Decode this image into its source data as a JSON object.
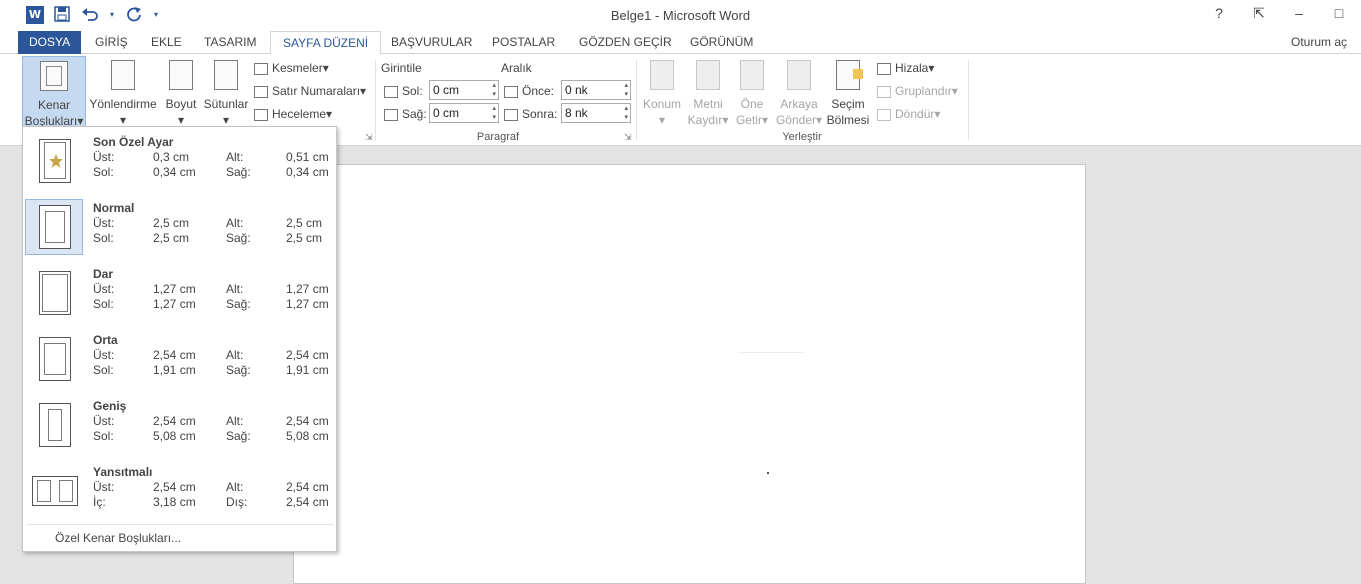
{
  "window": {
    "title": "Belge1 - Microsoft Word",
    "help": "?",
    "controls": [
      "⇱",
      "–",
      "□"
    ],
    "signin": "Oturum aç"
  },
  "qat": {
    "logo": "W",
    "save_icon": "save-icon",
    "undo_icon": "undo-icon",
    "redo_icon": "redo-icon"
  },
  "tabs": [
    "DOSYA",
    "GİRİŞ",
    "EKLE",
    "TASARIM",
    "SAYFA DÜZENİ",
    "BAŞVURULAR",
    "POSTALAR",
    "GÖZDEN GEÇİR",
    "GÖRÜNÜM"
  ],
  "ribbon": {
    "page_setup": {
      "margins": [
        "Kenar",
        "Boşlukları"
      ],
      "orientation": "Yönlendirme",
      "size": "Boyut",
      "columns": "Sütunlar",
      "breaks": "Kesmeler",
      "line_numbers": "Satır Numaraları",
      "hyphenation": "Heceleme"
    },
    "paragraph": {
      "indent_title": "Girintile",
      "spacing_title": "Aralık",
      "left_label": "Sol:",
      "left_value": "0 cm",
      "right_label": "Sağ:",
      "right_value": "0 cm",
      "before_label": "Önce:",
      "before_value": "0 nk",
      "after_label": "Sonra:",
      "after_value": "8 nk",
      "group_label": "Paragraf"
    },
    "arrange": {
      "position": [
        "Konum",
        "▾"
      ],
      "wrap_text": [
        "Metni",
        "Kaydır"
      ],
      "bring_forward": [
        "Öne",
        "Getir"
      ],
      "send_backward": [
        "Arkaya",
        "Gönder"
      ],
      "selection_pane": [
        "Seçim",
        "Bölmesi"
      ],
      "align": "Hizala",
      "group": "Gruplandır",
      "rotate": "Döndür",
      "group_label": "Yerleştir"
    }
  },
  "margins_menu": {
    "items": [
      {
        "name": "Son Özel Ayar",
        "l1": "Üst:",
        "v1": "0,3 cm",
        "l2": "Alt:",
        "v2": "0,51 cm",
        "l3": "Sol:",
        "v3": "0,34 cm",
        "l4": "Sağ:",
        "v4": "0,34 cm"
      },
      {
        "name": "Normal",
        "l1": "Üst:",
        "v1": "2,5 cm",
        "l2": "Alt:",
        "v2": "2,5 cm",
        "l3": "Sol:",
        "v3": "2,5 cm",
        "l4": "Sağ:",
        "v4": "2,5 cm"
      },
      {
        "name": "Dar",
        "l1": "Üst:",
        "v1": "1,27 cm",
        "l2": "Alt:",
        "v2": "1,27 cm",
        "l3": "Sol:",
        "v3": "1,27 cm",
        "l4": "Sağ:",
        "v4": "1,27 cm"
      },
      {
        "name": "Orta",
        "l1": "Üst:",
        "v1": "2,54 cm",
        "l2": "Alt:",
        "v2": "2,54 cm",
        "l3": "Sol:",
        "v3": "1,91 cm",
        "l4": "Sağ:",
        "v4": "1,91 cm"
      },
      {
        "name": "Geniş",
        "l1": "Üst:",
        "v1": "2,54 cm",
        "l2": "Alt:",
        "v2": "2,54 cm",
        "l3": "Sol:",
        "v3": "5,08 cm",
        "l4": "Sağ:",
        "v4": "5,08 cm"
      },
      {
        "name": "Yansıtmalı",
        "l1": "Üst:",
        "v1": "2,54 cm",
        "l2": "Alt:",
        "v2": "2,54 cm",
        "l3": "İç:",
        "v3": "3,18 cm",
        "l4": "Dış:",
        "v4": "2,54 cm"
      }
    ],
    "custom": "Özel Kenar Boşlukları..."
  }
}
